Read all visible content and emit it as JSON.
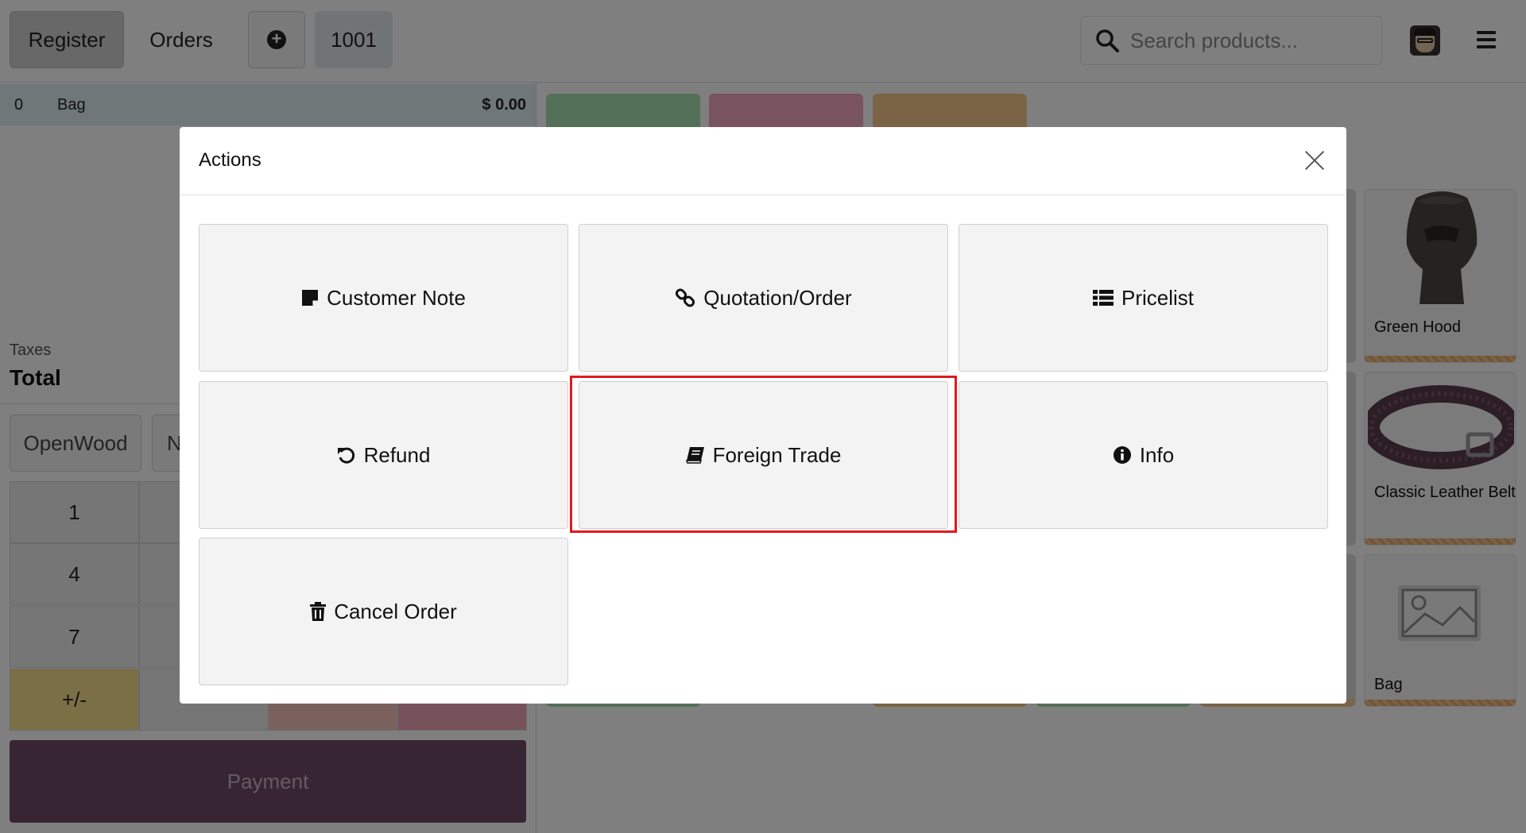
{
  "topbar": {
    "register_label": "Register",
    "orders_label": "Orders",
    "order_number": "1001",
    "search_placeholder": "Search products..."
  },
  "order": {
    "line": {
      "qty": "0",
      "name": "Bag",
      "price": "$ 0.00"
    },
    "taxes_label": "Taxes",
    "total_label": "Total"
  },
  "controls": {
    "openwood_label": "OpenWood",
    "partial_label": "N"
  },
  "numpad": {
    "keys": [
      "1",
      "4",
      "7",
      "+/-"
    ]
  },
  "payment_label": "Payment",
  "products": [
    {
      "name": "Green Hood"
    },
    {
      "name": "Classic Leather Belt"
    },
    {
      "name": "Bag"
    }
  ],
  "modal": {
    "title": "Actions",
    "actions": [
      {
        "label": "Customer Note",
        "icon": "sticky-note-icon"
      },
      {
        "label": "Quotation/Order",
        "icon": "link-icon"
      },
      {
        "label": "Pricelist",
        "icon": "list-icon"
      },
      {
        "label": "Refund",
        "icon": "undo-icon"
      },
      {
        "label": "Foreign Trade",
        "icon": "book-icon",
        "highlighted": true
      },
      {
        "label": "Info",
        "icon": "info-circle-icon"
      },
      {
        "label": "Cancel Order",
        "icon": "trash-icon"
      }
    ]
  },
  "colors": {
    "payment": "#714b67",
    "highlight": "#e0191e",
    "category_green": "#a9e0b3",
    "category_pink": "#f3a7bf",
    "category_orange": "#f7c98b"
  }
}
